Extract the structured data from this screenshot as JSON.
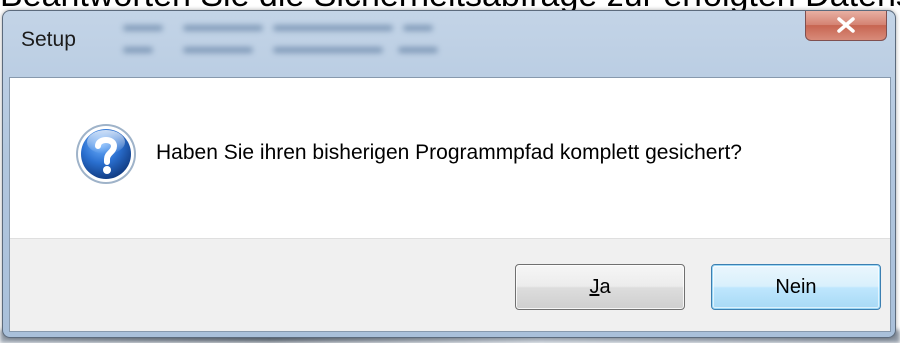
{
  "background": {
    "heading_fragment": "Beantworten Sie die Sicherheitsabfrage zur erfolgten Datensich"
  },
  "window": {
    "title": "Setup",
    "message": "Haben Sie ihren bisherigen Programmpfad komplett gesichert?",
    "icon": "question-icon",
    "buttons": {
      "yes_accel": "J",
      "yes_rest": "a",
      "no_label": "Nein"
    },
    "colors": {
      "frame": "#b1c6de",
      "close_button": "#d48272",
      "default_button_border": "#3c7fb1",
      "icon_blue": "#1f5fb0"
    }
  }
}
